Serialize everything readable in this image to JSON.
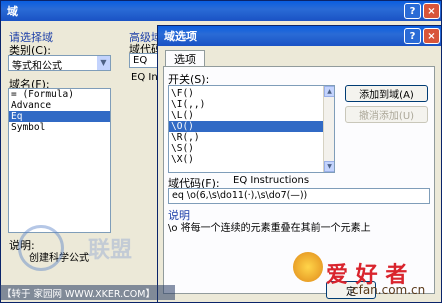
{
  "back_dialog": {
    "title": "域",
    "help": "?",
    "select_group": "请选择域",
    "category_label": "类别(C):",
    "category_value": "等式和公式",
    "field_names_label": "域名(F):",
    "field_names": [
      "= (Formula)",
      "Advance",
      "Eq",
      "Symbol"
    ],
    "selected_field_index": 2,
    "advanced_label": "高级域",
    "field_code_label": "域代码",
    "field_code_value": "EQ",
    "eq_instr_text": "EQ Instr",
    "description_label": "说明:",
    "description_text": "创建科学公式"
  },
  "front_dialog": {
    "title": "域选项",
    "help": "?",
    "close": "×",
    "tab_label": "选项",
    "switches_label": "开关(S):",
    "switches": [
      "\\F()",
      "\\I(,,)",
      "\\L()",
      "\\O()",
      "\\R(,)",
      "\\S()",
      "\\X()"
    ],
    "selected_switch_index": 3,
    "add_button": "添加到域(A)",
    "undo_button": "撤消添加(U)",
    "field_code_label": "域代码(F):",
    "field_code_title": "EQ Instructions",
    "field_code_value": "eq \\o(6,\\s\\do11(·),\\s\\do7(—))",
    "description_label": "说明",
    "description_text": "\\o 将每一个连续的元素重叠在其前一个元素上",
    "ok_fragment": "定"
  },
  "watermarks": {
    "left": "【转于 家园网 WWW.XKER.COM】",
    "right": "cfan.com.cn",
    "right_cn": "爱 好 者",
    "mid": "联盟"
  },
  "colors": {
    "title_blue": "#0a5ee0",
    "selection": "#316ac5",
    "dialog_bg": "#ece9d8"
  }
}
